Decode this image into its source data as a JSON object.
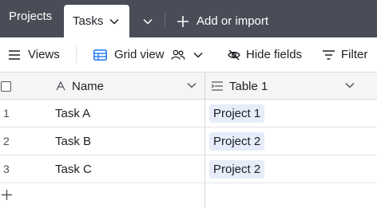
{
  "tabs": {
    "projects_label": "Projects",
    "tasks_label": "Tasks",
    "add_import_label": "Add or import"
  },
  "viewbar": {
    "views_label": "Views",
    "grid_view_label": "Grid view",
    "hide_fields_label": "Hide fields",
    "filter_label": "Filter"
  },
  "columns": {
    "name_label": "Name",
    "table1_label": "Table 1"
  },
  "rows": [
    {
      "num": "1",
      "name": "Task A",
      "link": "Project 1"
    },
    {
      "num": "2",
      "name": "Task B",
      "link": "Project 2"
    },
    {
      "num": "3",
      "name": "Task C",
      "link": "Project 2"
    }
  ],
  "colors": {
    "tabbar_bg": "#4a4d57",
    "header_bg": "#f5f5f5",
    "pill_bg": "#e6ecf9",
    "grid_icon": "#2d7ff9"
  }
}
